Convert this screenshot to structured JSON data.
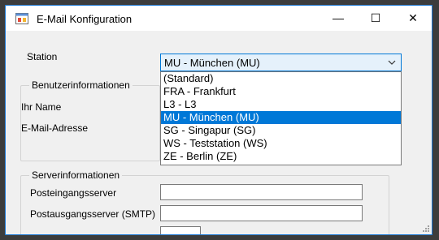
{
  "window": {
    "title": "E-Mail Konfiguration",
    "minimize_glyph": "—",
    "maximize_glyph": "☐",
    "close_glyph": "✕"
  },
  "station": {
    "label": "Station",
    "selected": "MU - München (MU)",
    "options": [
      "(Standard)",
      "FRA - Frankfurt",
      "L3 - L3",
      "MU - München (MU)",
      "SG - Singapur (SG)",
      "WS - Teststation (WS)",
      "ZE - Berlin (ZE)"
    ],
    "selected_index": 3
  },
  "user_info": {
    "title": "Benutzerinformationen",
    "name_label": "Ihr Name",
    "email_label": "E-Mail-Adresse"
  },
  "server_info": {
    "title": "Serverinformationen",
    "incoming_label": "Posteingangsserver",
    "outgoing_label": "Postausgangsserver (SMTP)"
  },
  "icons": {
    "app": "window-app-icon",
    "dropdown": "chevron-down-icon",
    "resize": "resize-grip-icon"
  }
}
